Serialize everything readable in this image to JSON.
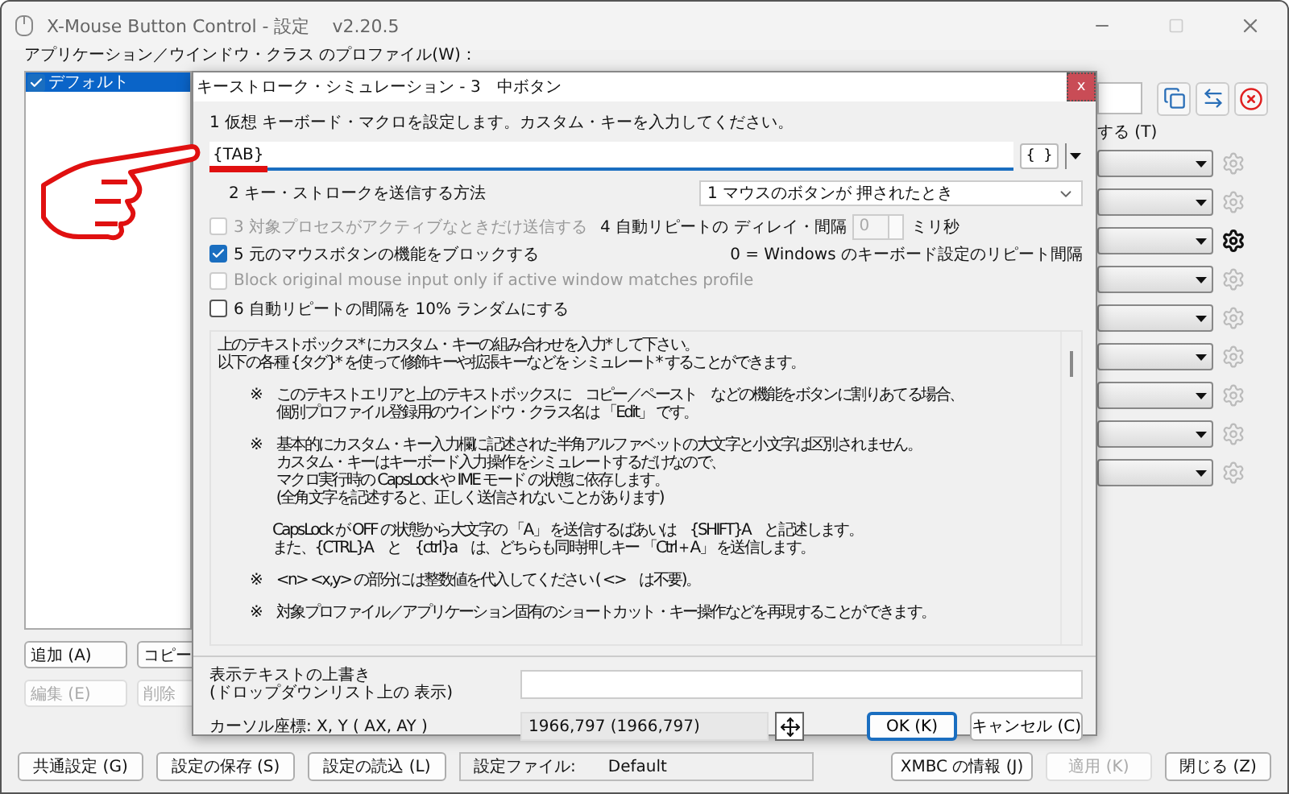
{
  "window": {
    "title": "X-Mouse Button Control - 設定",
    "version": "v2.20.5"
  },
  "profiles": {
    "label": "アプリケーション／ウインドウ・クラス のプロファイル(W)：",
    "items": [
      {
        "name": "デフォルト",
        "checked": true,
        "selected": true
      }
    ]
  },
  "profile_buttons": [
    {
      "label": "追加 (A)",
      "disabled": false
    },
    {
      "label": "コピー",
      "disabled": false
    },
    {
      "label": "編集 (E)",
      "disabled": true
    },
    {
      "label": "削除",
      "disabled": true
    }
  ],
  "layer_option_label": "する (T)",
  "button_rows": [
    {
      "gear_enabled": false
    },
    {
      "gear_enabled": false
    },
    {
      "gear_enabled": true
    },
    {
      "gear_enabled": false
    },
    {
      "gear_enabled": false
    },
    {
      "gear_enabled": false
    },
    {
      "gear_enabled": false
    },
    {
      "gear_enabled": false
    },
    {
      "gear_enabled": false
    }
  ],
  "bottom_bar": {
    "buttons_left": [
      {
        "label": "共通設定 (G)",
        "disabled": false
      },
      {
        "label": "設定の保存 (S)",
        "disabled": false
      },
      {
        "label": "設定の読込 (L)",
        "disabled": false
      }
    ],
    "settings_file": {
      "label": "設定ファイル:",
      "value": "Default"
    },
    "buttons_right": [
      {
        "label": "XMBC の情報 (J)",
        "disabled": false
      },
      {
        "label": "適用 (K)",
        "disabled": true
      },
      {
        "label": "閉じる (Z)",
        "disabled": false
      }
    ]
  },
  "dialog": {
    "title": "キーストローク・シミュレーション - 3　中ボタン",
    "close": "x",
    "macro_label": "1 仮想 キーボード・マクロを設定します。カスタム・キーを入力してください。",
    "macro_value": "{TAB}",
    "tag_button": "{ }",
    "send_method": {
      "label": "2 キー・ストロークを送信する方法",
      "value": "1 マウスのボタンが 押されたとき"
    },
    "only_active": {
      "label": "3 対象プロセスがアクティブなときだけ送信する",
      "checked": false,
      "disabled": true
    },
    "repeat_delay": {
      "label": "4 自動リピートの ディレイ・間隔",
      "value": "0",
      "disabled": true,
      "unit": "ミリ秒",
      "note": "0 = Windows のキーボード設定のリピート間隔"
    },
    "block_original": {
      "label": "5 元のマウスボタンの機能をブロックする",
      "checked": true,
      "disabled": false
    },
    "block_if_active": {
      "label": "Block original mouse input only if active window matches profile",
      "checked": false,
      "disabled": true
    },
    "random_repeat": {
      "label": "6 自動リピートの間隔を 10% ランダムにする",
      "checked": false,
      "disabled": false
    },
    "help": [
      {
        "kind": "intro",
        "lines": [
          "上のテキストボックス* にカスタム・キーの組み合わせを入力* して下さい。",
          "以下の各種 {タグ}* を使って修飾キーや拡張キーなどを シミュレート* することができます。"
        ]
      },
      {
        "kind": "note",
        "mark": "※",
        "lines": [
          "このテキストエリアと上のテキストボックスに　コピー／ペースト　などの機能をボタンに割りあてる場合、",
          "個別プロファイル登録用のウインドウ・クラス名は 「Edit」 です。"
        ]
      },
      {
        "kind": "note",
        "mark": "※",
        "lines": [
          "基本的にカスタム・キー入力欄に記述された半角アルファベットの大文字と小文字は区別されません。",
          "カスタム・キーはキーボード入力操作をシミュレートするだけなので、",
          "マクロ実行時の CapsLock や IME モード の状態に依存します。",
          "(全角文字を記述すると、正しく送信されないことがあります)"
        ]
      },
      {
        "kind": "continuation",
        "lines": [
          "CapsLock が OFF の状態から大文字の 「A」 を送信するばあいは　{SHIFT}A　と記述します。",
          "また、{CTRL}A　と　{ctrl}a　は、どちらも同時押しキー 「Ctrl＋A」 を送信します。"
        ]
      },
      {
        "kind": "note",
        "mark": "※",
        "lines": [
          "<n> <x,y> の部分には整数値を代入してください ( <>　は不要)。"
        ]
      },
      {
        "kind": "note",
        "mark": "※",
        "lines": [
          "対象プロファイル／アプリケーション固有のショートカット・キー操作などを再現することができます。"
        ]
      }
    ],
    "override": {
      "lines": [
        "表示テキストの上書き",
        "(ドロップダウンリスト上の 表示)"
      ]
    },
    "cursor": {
      "label": "カーソル座標:  X, Y  ( AX, AY )",
      "value": "1966,797 (1966,797)"
    },
    "buttons": [
      {
        "label": "OK (K)",
        "default": true
      },
      {
        "label": "キャンセル (C)",
        "default": false
      }
    ]
  }
}
